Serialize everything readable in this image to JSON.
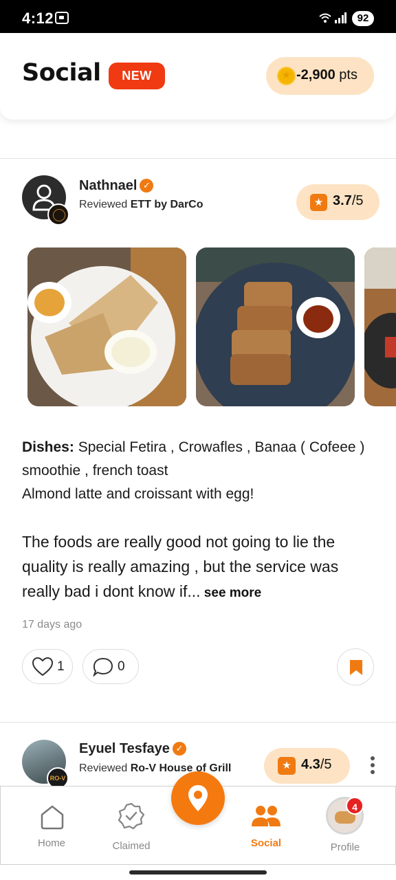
{
  "status_bar": {
    "time": "4:12",
    "battery": "92"
  },
  "header": {
    "title": "Social",
    "badge": "NEW",
    "points_value": "-2,900",
    "points_unit": " pts"
  },
  "post1": {
    "user_name": "Nathnael",
    "reviewed_prefix": "Reviewed ",
    "restaurant": "ETT by DarCo",
    "rating": "3.7",
    "rating_suffix": "/5",
    "dishes_label": "Dishes:",
    "dishes_text": " Special Fetira , Crowafles , Banaa ( Cofeee ) smoothie ,  french toast",
    "dishes_line2": "Almond latte  and croissant with egg!",
    "review_text": "The foods are really good not going to lie the quality is really amazing , but the service was really bad i dont know if...",
    "see_more": " see more",
    "time_ago": "17 days ago",
    "likes": "1",
    "comments": "0"
  },
  "post2": {
    "user_name": "Eyuel Tesfaye",
    "reviewed_prefix": "Reviewed ",
    "restaurant": "Ro-V House of Grill",
    "rating": "4.3",
    "rating_suffix": "/5",
    "mini_logo": "RO-V"
  },
  "bottom_nav": {
    "items": [
      {
        "label": "Home",
        "icon": "home-icon"
      },
      {
        "label": "Claimed",
        "icon": "badge-check-icon"
      },
      {
        "label": "Social",
        "icon": "people-icon",
        "active": true
      },
      {
        "label": "Profile",
        "icon": "avatar"
      }
    ],
    "profile_badge": "4"
  },
  "colors": {
    "accent": "#f07a12",
    "new_badge": "#ef3a12",
    "pill_bg": "#fde3c4",
    "notif": "#e52222"
  }
}
